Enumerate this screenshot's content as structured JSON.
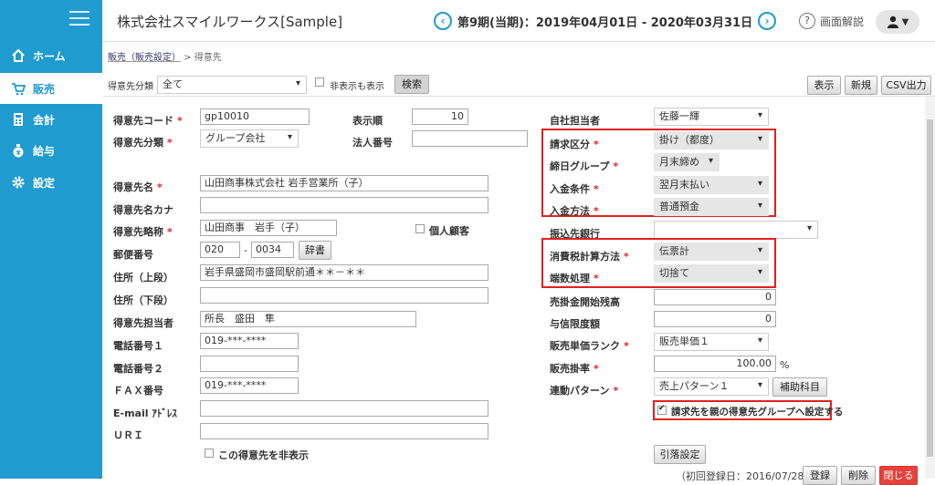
{
  "app": {
    "company": "株式会社スマイルワークス[Sample]",
    "period": "第9期(当期)：2019年04月01日 - 2020年03月31日",
    "help": "画面解説"
  },
  "sidebar": {
    "items": [
      {
        "label": "ホーム"
      },
      {
        "label": "販売"
      },
      {
        "label": "会計"
      },
      {
        "label": "給与"
      },
      {
        "label": "設定"
      }
    ]
  },
  "breadcrumb": {
    "parent": "販売（販売設定）",
    "sep": ">",
    "current": "得意先"
  },
  "toolbar": {
    "filter_label": "得意先分類",
    "filter_value": "全て",
    "show_hidden_label": "非表示も表示",
    "search": "検索",
    "view": "表示",
    "new": "新規",
    "csv": "CSV出力"
  },
  "form": {
    "code": {
      "label": "得意先コード",
      "value": "gp10010"
    },
    "order": {
      "label": "表示順",
      "value": "10"
    },
    "category": {
      "label": "得意先分類",
      "value": "グループ会社"
    },
    "corp_no": {
      "label": "法人番号",
      "value": ""
    },
    "name": {
      "label": "得意先名",
      "value": "山田商事株式会社 岩手営業所（子）"
    },
    "kana": {
      "label": "得意先名カナ",
      "value": ""
    },
    "short": {
      "label": "得意先略称",
      "value": "山田商事　岩手（子）"
    },
    "individual": {
      "label": "個人顧客"
    },
    "zip": {
      "label": "郵便番号",
      "value1": "020",
      "dash": "-",
      "value2": "0034",
      "dict": "辞書"
    },
    "addr1": {
      "label": "住所（上段）",
      "value": "岩手県盛岡市盛岡駅前通＊＊－＊＊"
    },
    "addr2": {
      "label": "住所（下段）",
      "value": ""
    },
    "contact": {
      "label": "得意先担当者",
      "value": "所長　盛田　隼"
    },
    "tel1": {
      "label": "電話番号１",
      "value": "019-***-****"
    },
    "tel2": {
      "label": "電話番号２",
      "value": ""
    },
    "fax": {
      "label": "ＦＡＸ番号",
      "value": "019-***-****"
    },
    "email": {
      "label": "E-mail ｱﾄﾞﾚｽ",
      "value": ""
    },
    "uri": {
      "label": "ＵＲＩ",
      "value": ""
    },
    "hide": {
      "label": "この得意先を非表示"
    },
    "staff": {
      "label": "自社担当者",
      "value": "佐藤一輝"
    },
    "billing": {
      "label": "請求区分",
      "value": "掛け（都度）"
    },
    "closing": {
      "label": "締日グループ",
      "value": "月末締め"
    },
    "payment_terms": {
      "label": "入金条件",
      "value": "翌月末払い"
    },
    "payment_method": {
      "label": "入金方法",
      "value": "普通預金"
    },
    "bank": {
      "label": "振込先銀行",
      "value": ""
    },
    "tax_method": {
      "label": "消費税計算方法",
      "value": "伝票計"
    },
    "rounding": {
      "label": "端数処理",
      "value": "切捨て"
    },
    "ar_balance": {
      "label": "売掛金開始残高",
      "value": "0"
    },
    "credit": {
      "label": "与信限度額",
      "value": "0"
    },
    "price_rank": {
      "label": "販売単価ランク",
      "value": "販売単価１"
    },
    "rate": {
      "label": "販売掛率",
      "value": "100.00",
      "unit": "%"
    },
    "pattern": {
      "label": "連動パターン",
      "value": "売上パターン１",
      "aux": "補助科目"
    },
    "parent_billing": {
      "label": "請求先を親の得意先グループへ設定する"
    },
    "transfer": "引落設定",
    "footer": {
      "reg_date": "（初回登録日：2016/07/28）",
      "register": "登録",
      "delete": "削除",
      "close": "閉じる"
    }
  },
  "colors": {
    "accent": "#1f9bcf",
    "highlight": "#e02020"
  }
}
